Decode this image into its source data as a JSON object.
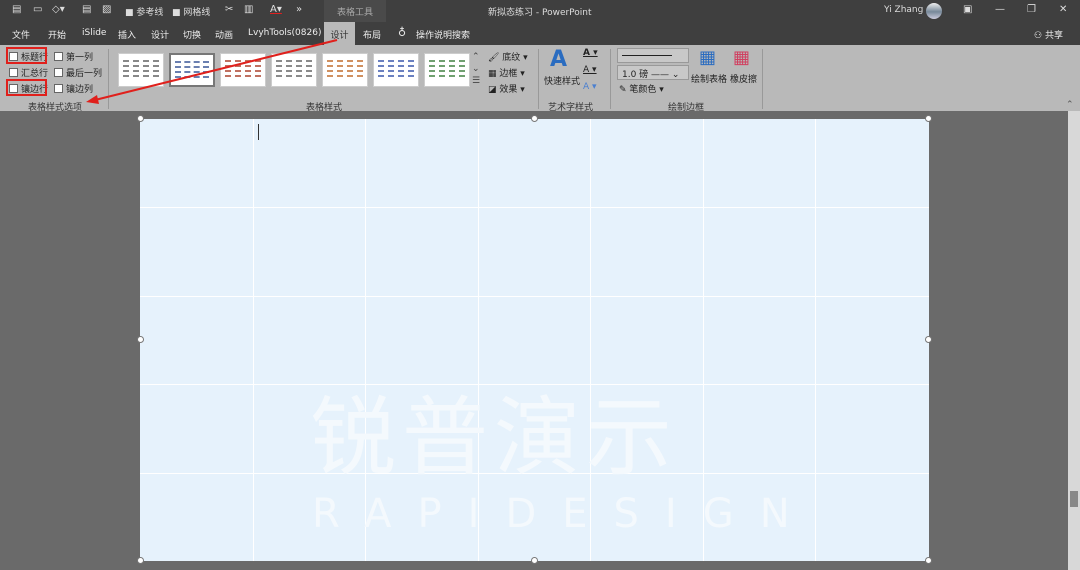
{
  "titlebar": {
    "doc_title": "新拟态练习 - PowerPoint",
    "context_tab": "表格工具",
    "user": "Yi Zhang",
    "qat": {
      "guides": "参考线",
      "gridlines": "网格线",
      "more": "»"
    }
  },
  "tabs": [
    "文件",
    "开始",
    "iSlide",
    "插入",
    "设计",
    "切换",
    "动画",
    "LvyhTools(0826)",
    "设计",
    "布局"
  ],
  "active_tab_index": 8,
  "tell_me": "操作说明搜索",
  "share": "共享",
  "ribbon": {
    "table_style_options": {
      "items": [
        {
          "label": "标题行",
          "checked": false,
          "highlighted": true
        },
        {
          "label": "第一列",
          "checked": false
        },
        {
          "label": "汇总行",
          "checked": false
        },
        {
          "label": "最后一列",
          "checked": false
        },
        {
          "label": "镶边行",
          "checked": false,
          "highlighted": true
        },
        {
          "label": "镶边列",
          "checked": false
        }
      ],
      "group_label": "表格样式选项"
    },
    "table_styles": {
      "group_label": "表格样式",
      "shading": "底纹",
      "borders": "边框",
      "effects": "效果",
      "style_colors": [
        "#888888",
        "#6a7fb0",
        "#c07060",
        "#8a8a8a",
        "#d09060",
        "#6a80c0",
        "#70a070"
      ]
    },
    "wordart": {
      "quick_styles": "快速样式",
      "group_label": "艺术字样式"
    },
    "draw_borders": {
      "pen_weight": "1.0 磅",
      "pen_color": "笔颜色",
      "draw_table": "绘制表格",
      "eraser": "橡皮擦",
      "group_label": "绘制边框"
    }
  },
  "slide": {
    "watermark_cn": "锐普演示",
    "watermark_en": "RAPIDESIGN",
    "background": "#e6f2fc"
  },
  "annotation_color": "#e0201c"
}
